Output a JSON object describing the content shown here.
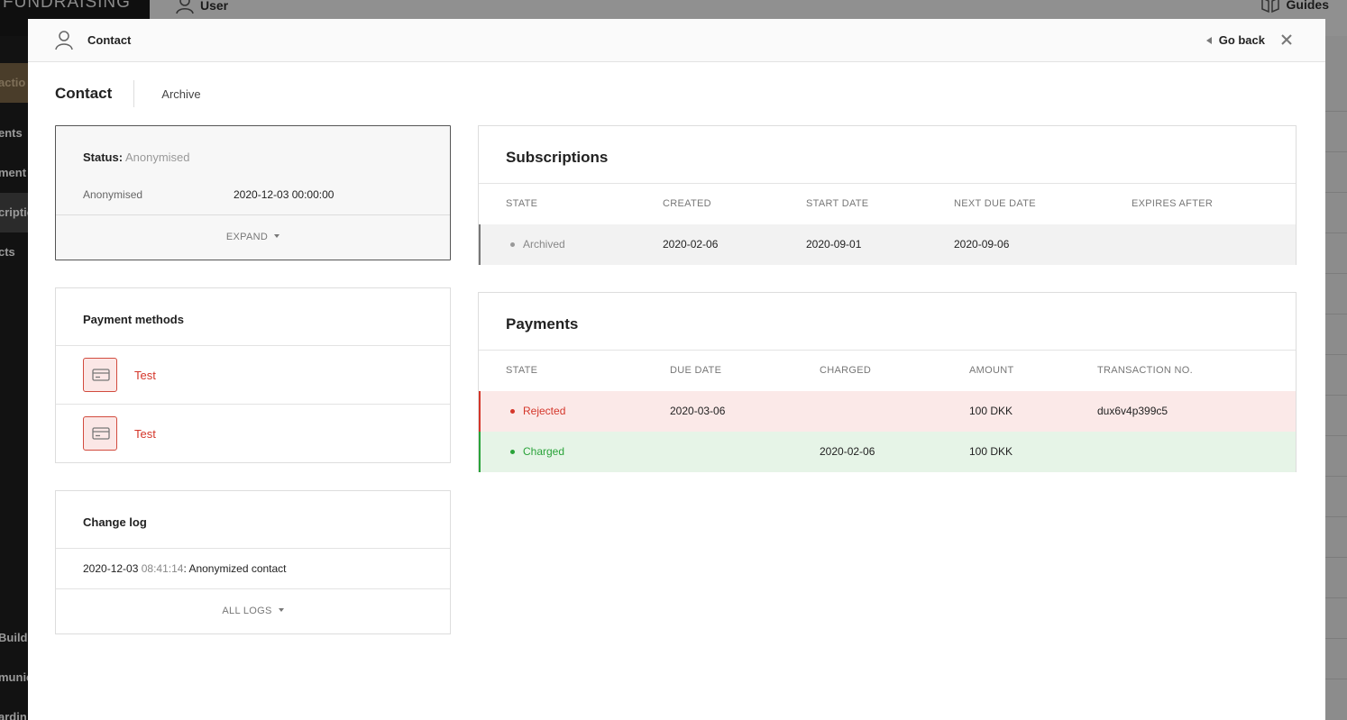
{
  "background": {
    "logo": "FUNDRAISING",
    "user_label": "User",
    "guides_label": "Guides",
    "sidebar_items": [
      "actio",
      "ents",
      "ment",
      "criptio",
      "cts",
      "Build",
      "munic",
      "ardin"
    ]
  },
  "modal": {
    "header_title": "Contact",
    "go_back": "Go back",
    "tab_main": "Contact",
    "tab_archive": "Archive"
  },
  "status": {
    "label": "Status:",
    "value": "Anonymised",
    "anon_label": "Anonymised",
    "anon_value": "2020-12-03 00:00:00",
    "expand": "EXPAND"
  },
  "payment_methods": {
    "title": "Payment methods",
    "items": [
      {
        "label": "Test"
      },
      {
        "label": "Test"
      }
    ]
  },
  "change_log": {
    "title": "Change log",
    "entry_date": "2020-12-03",
    "entry_time": "08:41:14",
    "entry_text": ": Anonymized contact",
    "all_logs": "ALL LOGS"
  },
  "subscriptions": {
    "title": "Subscriptions",
    "columns": [
      "STATE",
      "CREATED",
      "START DATE",
      "NEXT DUE DATE",
      "EXPIRES AFTER"
    ],
    "rows": [
      {
        "state": "Archived",
        "created": "2020-02-06",
        "start_date": "2020-09-01",
        "next_due_date": "2020-09-06",
        "expires_after": ""
      }
    ]
  },
  "payments": {
    "title": "Payments",
    "columns": [
      "STATE",
      "DUE DATE",
      "CHARGED",
      "AMOUNT",
      "TRANSACTION NO."
    ],
    "rows": [
      {
        "state": "Rejected",
        "due_date": "2020-03-06",
        "charged": "",
        "amount": "100 DKK",
        "transaction_no": "dux6v4p399c5"
      },
      {
        "state": "Charged",
        "due_date": "",
        "charged": "2020-02-06",
        "amount": "100 DKK",
        "transaction_no": ""
      }
    ]
  },
  "colors": {
    "rejected": "#d4362a",
    "charged": "#2aa33a",
    "archived": "#888888"
  }
}
